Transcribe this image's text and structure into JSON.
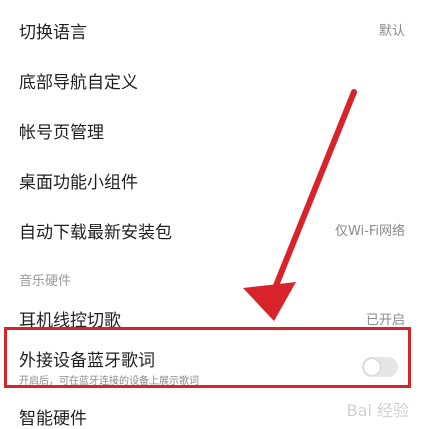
{
  "settings": {
    "items": [
      {
        "label": "切换语言",
        "value": "默认"
      },
      {
        "label": "底部导航自定义",
        "value": ""
      },
      {
        "label": "帐号页管理",
        "value": ""
      },
      {
        "label": "桌面功能小组件",
        "value": ""
      },
      {
        "label": "自动下载最新安装包",
        "value": "仅Wi-Fi网络"
      }
    ],
    "section_title": "音乐硬件",
    "music_items": [
      {
        "label": "耳机线控切歌",
        "value": "已开启"
      },
      {
        "label": "外接设备蓝牙歌词",
        "subtitle": "开启后，可在蓝牙连接的设备上展示歌词",
        "toggle_on": false
      },
      {
        "label": "智能硬件",
        "value": ""
      }
    ]
  },
  "annotation": {
    "arrow_color": "#d8232a",
    "box_color": "#d8232a"
  },
  "watermark": {
    "text": "Bai 经验"
  }
}
